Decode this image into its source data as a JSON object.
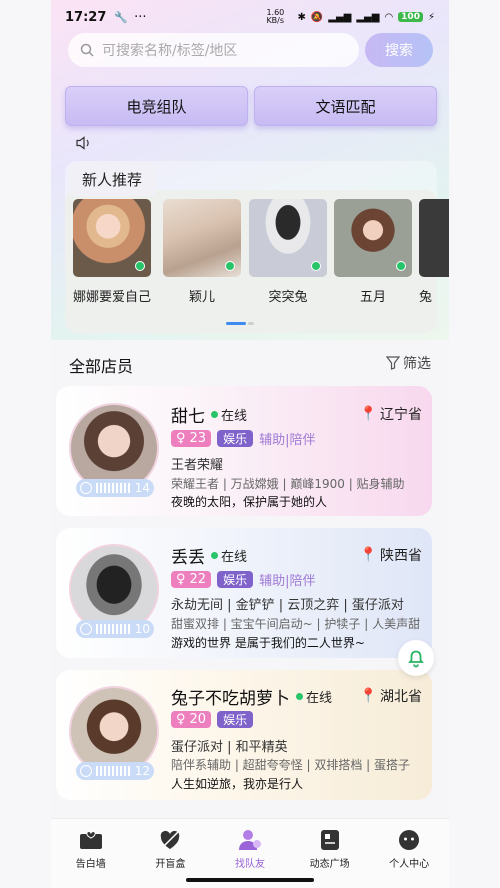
{
  "status": {
    "time": "17:27",
    "net_speed": "1.60 KB/s",
    "battery": "100"
  },
  "search": {
    "placeholder": "可搜索名称/标签/地区",
    "button": "搜索"
  },
  "tabs": [
    {
      "label": "电竞组队"
    },
    {
      "label": "文语匹配"
    }
  ],
  "new_recommend": {
    "title": "新人推荐",
    "items": [
      {
        "name": "娜娜要爱自己",
        "online": true
      },
      {
        "name": "颖儿",
        "online": true
      },
      {
        "name": "突突兔",
        "online": true
      },
      {
        "name": "五月",
        "online": true
      },
      {
        "name": "兔",
        "online": false
      }
    ]
  },
  "list": {
    "title": "全部店员",
    "filter": "筛选"
  },
  "cards": [
    {
      "name": "甜七",
      "status": "在线",
      "location": "辽宁省",
      "age": "23",
      "category": "娱乐",
      "roles": "辅助|陪伴",
      "voice_seconds": "14",
      "games": "王者荣耀",
      "skills": "荣耀王者 | 万战嫦娥 | 巅峰1900 | 贴身辅助",
      "motto": "夜晚的太阳，保护属于她的人"
    },
    {
      "name": "丢丢",
      "status": "在线",
      "location": "陕西省",
      "age": "22",
      "category": "娱乐",
      "roles": "辅助|陪伴",
      "voice_seconds": "10",
      "games": "永劫无间 | 金铲铲 | 云顶之弈 | 蛋仔派对",
      "skills": "甜蜜双排 | 宝宝午间启动~ | 护犊子 | 人美声甜...",
      "motto": "游戏的世界 是属于我们的二人世界~"
    },
    {
      "name": "兔子不吃胡萝卜",
      "status": "在线",
      "location": "湖北省",
      "age": "20",
      "category": "娱乐",
      "roles": "",
      "voice_seconds": "12",
      "games": "蛋仔派对 | 和平精英",
      "skills": "陪伴系辅助 | 超甜夸夸怪 | 双排搭档 | 蛋搭子",
      "motto": "人生如逆旅，我亦是行人"
    }
  ],
  "nav": [
    {
      "label": "告白墙",
      "icon": "heart-envelope-icon"
    },
    {
      "label": "开盲盒",
      "icon": "blind-box-icon"
    },
    {
      "label": "找队友",
      "icon": "find-teammate-icon",
      "active": true
    },
    {
      "label": "动态广场",
      "icon": "feed-icon"
    },
    {
      "label": "个人中心",
      "icon": "profile-icon"
    }
  ],
  "colors": {
    "accent": "#9a63d8",
    "online": "#28c46a",
    "age_tag": "#ee7fbf",
    "category_tag": "#7f63cb"
  }
}
